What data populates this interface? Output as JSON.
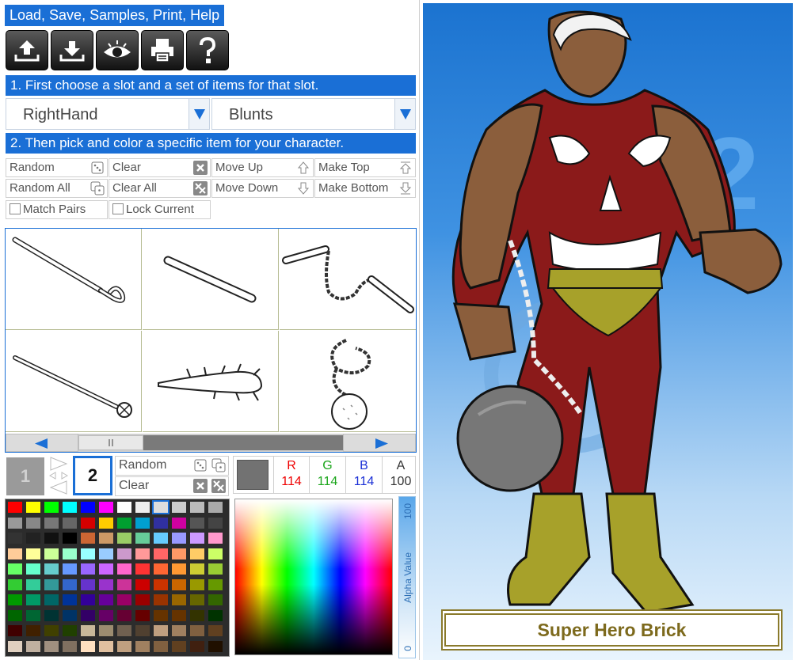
{
  "menu": {
    "title": "Load, Save, Samples, Print, Help"
  },
  "toolbar": {
    "icons": [
      "upload-icon",
      "download-icon",
      "eye-icon",
      "printer-icon",
      "help-icon"
    ]
  },
  "steps": {
    "step1": "1. First choose a slot and a set of items for that slot.",
    "step2": "2. Then pick and color a specific item for your character."
  },
  "slot_select": {
    "value": "RightHand"
  },
  "set_select": {
    "value": "Blunts"
  },
  "actions": {
    "random": "Random",
    "clear": "Clear",
    "move_up": "Move Up",
    "make_top": "Make Top",
    "random_all": "Random All",
    "clear_all": "Clear All",
    "move_down": "Move Down",
    "make_bottom": "Make Bottom",
    "match_pairs": "Match Pairs",
    "lock_current": "Lock Current"
  },
  "items": [
    "cane",
    "baton",
    "nunchaku",
    "mace-staff",
    "spiked-club",
    "ball-and-chain"
  ],
  "color_slots": {
    "slot1": "1",
    "slot2": "2",
    "random": "Random",
    "clear": "Clear"
  },
  "color": {
    "r_label": "R",
    "g_label": "G",
    "b_label": "B",
    "a_label": "A",
    "r": "114",
    "g": "114",
    "b": "114",
    "a": "100",
    "swatch": "#727272"
  },
  "alpha_slider": {
    "label": "Alpha Value",
    "max": "100",
    "min": "0"
  },
  "character": {
    "name": "Super Hero Brick"
  },
  "colors": {
    "accent": "#1a6fd6",
    "name_text": "#7d6a1d",
    "suit": "#8b1a1a",
    "boots": "#a7a12a"
  }
}
